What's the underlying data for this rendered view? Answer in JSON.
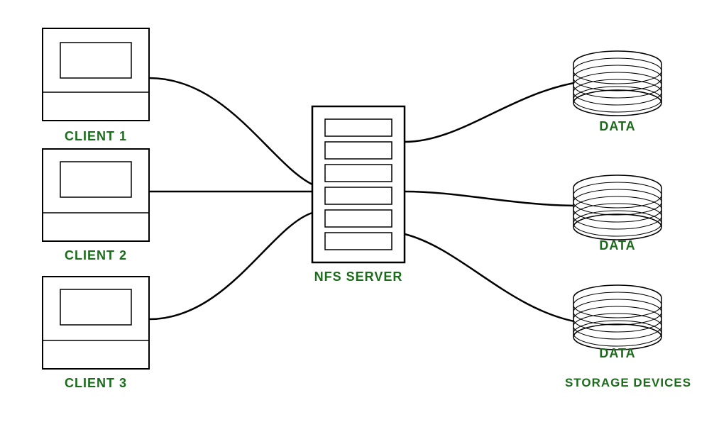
{
  "labels": {
    "client1": "CLIENT 1",
    "client2": "CLIENT 2",
    "client3": "CLIENT 3",
    "nfsServer": "NFS SERVER",
    "data1": "DATA",
    "data2": "DATA",
    "data3": "DATA",
    "storageDevices": "STORAGE DEVICES"
  },
  "colors": {
    "green": "#1a6b1a",
    "black": "#000",
    "white": "#fff",
    "border": "#000"
  }
}
